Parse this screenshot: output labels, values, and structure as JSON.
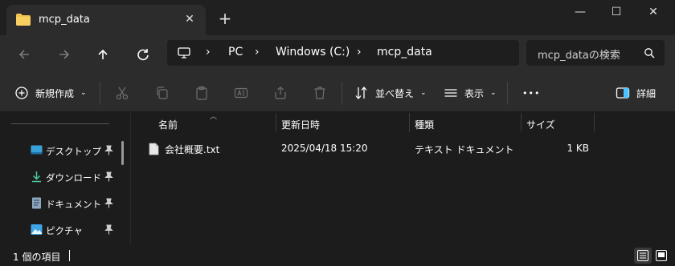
{
  "window": {
    "tab_title": "mcp_data",
    "close_tab": "✕",
    "new_tab": "+",
    "minimize": "—",
    "maximize": "☐",
    "close": "✕"
  },
  "address": {
    "crumbs": [
      "PC",
      "Windows (C:)",
      "mcp_data"
    ],
    "separator": "›"
  },
  "search": {
    "placeholder": "mcp_dataの検索"
  },
  "commands": {
    "new_label": "新規作成",
    "sort_label": "並べ替え",
    "view_label": "表示",
    "more_label": "•••",
    "details_label": "詳細"
  },
  "sidebar": {
    "items": [
      {
        "label": "デスクトップ",
        "icon": "desktop-icon"
      },
      {
        "label": "ダウンロード",
        "icon": "download-icon"
      },
      {
        "label": "ドキュメント",
        "icon": "document-icon"
      },
      {
        "label": "ピクチャ",
        "icon": "pictures-icon"
      }
    ]
  },
  "columns": [
    "名前",
    "更新日時",
    "種類",
    "サイズ"
  ],
  "files": [
    {
      "name": "会社概要.txt",
      "modified": "2025/04/18 15:20",
      "type": "テキスト ドキュメント",
      "size": "1 KB"
    }
  ],
  "status": {
    "item_count": "1 個の項目"
  },
  "colors": {
    "accent": "#4cc2ff",
    "folder": "#f3c54d",
    "background": "#1c1c1c",
    "chrome": "#2c2c2c"
  }
}
